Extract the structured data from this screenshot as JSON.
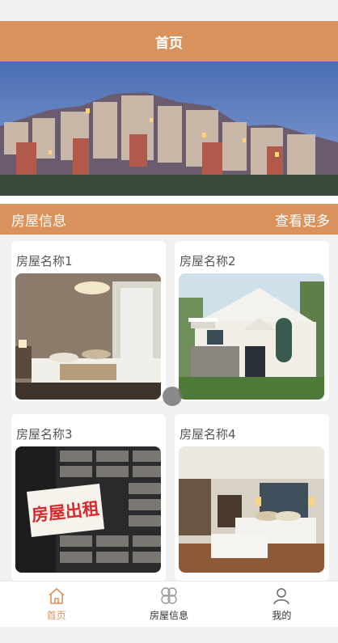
{
  "header": {
    "title": "首页"
  },
  "section": {
    "title": "房屋信息",
    "more_label": "查看更多"
  },
  "houses": [
    {
      "name": "房屋名称1",
      "image": "bedroom-photo"
    },
    {
      "name": "房屋名称2",
      "image": "villa-photo"
    },
    {
      "name": "房屋名称3",
      "image": "rent-sign-photo",
      "sign_text": "房屋出租"
    },
    {
      "name": "房屋名称4",
      "image": "hotel-room-photo"
    }
  ],
  "tabbar": {
    "items": [
      {
        "label": "首页",
        "icon": "home-icon",
        "active": true
      },
      {
        "label": "房屋信息",
        "icon": "clover-icon",
        "active": false
      },
      {
        "label": "我的",
        "icon": "person-icon",
        "active": false
      }
    ]
  },
  "colors": {
    "accent": "#d9925c",
    "background": "#f1f1f1"
  }
}
